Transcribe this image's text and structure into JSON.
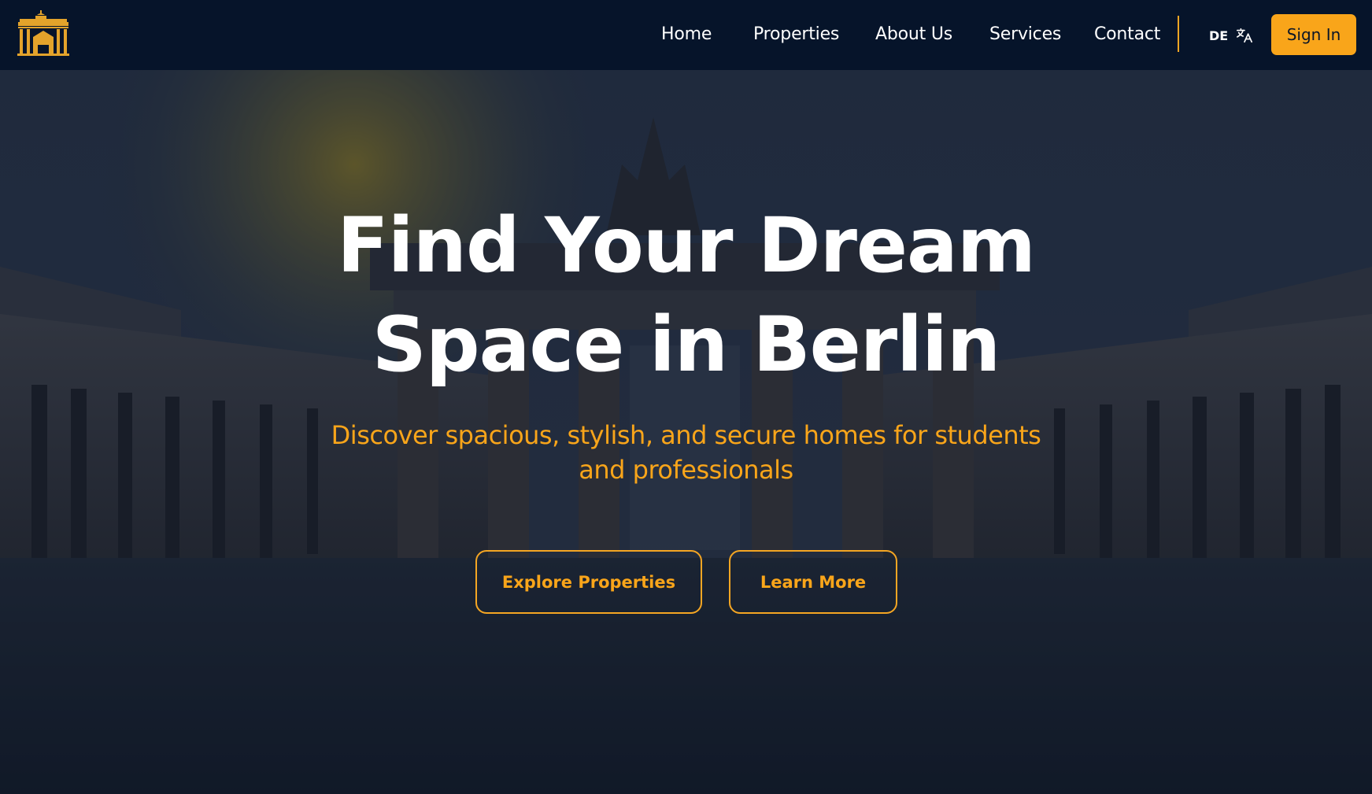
{
  "brand": {
    "logo_icon": "brandenburg-gate-house-icon",
    "accent_color": "#f9a51a",
    "nav_background": "#06142a"
  },
  "nav": {
    "links": [
      "Home",
      "Properties",
      "About Us",
      "Services",
      "Contact"
    ],
    "language": {
      "code": "DE",
      "icon": "translate-icon"
    },
    "signin_label": "Sign In"
  },
  "hero": {
    "background_icon": "brandenburg-gate-photo",
    "title_line1": "Find Your Dream",
    "title_line2": "Space in Berlin",
    "subtitle": "Discover spacious, stylish, and secure homes for students and professionals",
    "primary_button": "Explore Properties",
    "secondary_button": "Learn More"
  }
}
